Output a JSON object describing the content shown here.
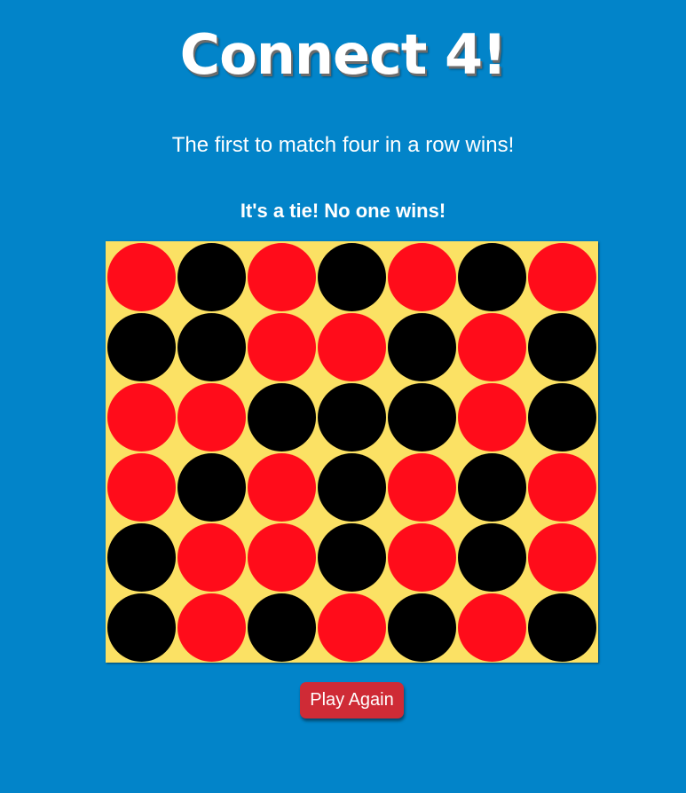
{
  "header": {
    "title": "Connect 4!",
    "subtitle": "The first to match four in a row wins!"
  },
  "status": {
    "message": "It's a tie! No one wins!"
  },
  "colors": {
    "background": "#0284c9",
    "board": "#fbe164",
    "red": "#ff0c1a",
    "black": "#000000",
    "button": "#cf2b36"
  },
  "board": {
    "rows": 6,
    "columns": 7,
    "cells": [
      [
        "red",
        "black",
        "red",
        "black",
        "red",
        "black",
        "red"
      ],
      [
        "black",
        "black",
        "red",
        "red",
        "black",
        "red",
        "black"
      ],
      [
        "red",
        "red",
        "black",
        "black",
        "black",
        "red",
        "black"
      ],
      [
        "red",
        "black",
        "red",
        "black",
        "red",
        "black",
        "red"
      ],
      [
        "black",
        "red",
        "red",
        "black",
        "red",
        "black",
        "red"
      ],
      [
        "black",
        "red",
        "black",
        "red",
        "black",
        "red",
        "black"
      ]
    ]
  },
  "controls": {
    "play_again_label": "Play Again"
  }
}
